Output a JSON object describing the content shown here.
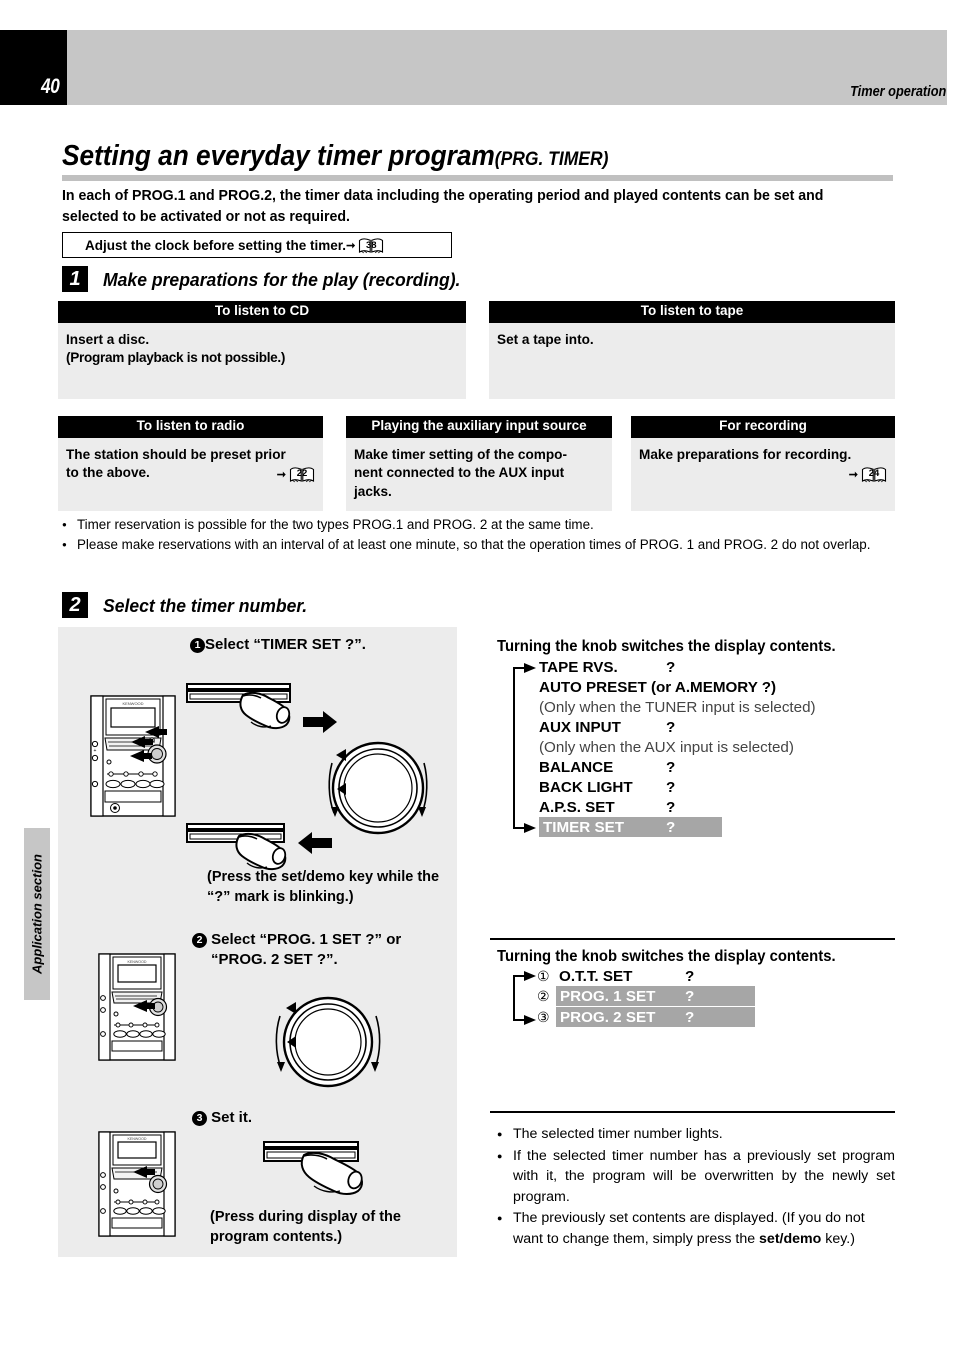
{
  "header": {
    "page_number": "40",
    "section_title": "Timer operation",
    "side_tab_label": "Application section"
  },
  "title": {
    "main": "Setting an everyday timer program",
    "suffix": "(PRG. TIMER)"
  },
  "intro": "In each of PROG.1 and PROG.2, the timer data including the operating period and played contents can be set and selected to be activated or not as required.",
  "note_box": {
    "text": "Adjust the clock before setting the timer.",
    "arrow": "➜",
    "page_ref": "38"
  },
  "step1": {
    "badge": "1",
    "heading": "Make preparations for the play (recording).",
    "boxes": [
      {
        "title": "To listen to CD",
        "lines": [
          "Insert a disc.",
          "(Program playback is not possible.)"
        ],
        "page_ref": ""
      },
      {
        "title": "To listen to tape",
        "lines": [
          "Set a tape into."
        ],
        "page_ref": ""
      },
      {
        "title": "To listen to radio",
        "lines": [
          "The station should be preset prior",
          "to the above."
        ],
        "page_ref": "22"
      },
      {
        "title": "Playing the auxiliary input source",
        "lines": [
          "Make timer setting of the compo-",
          "nent connected to the AUX input",
          "jacks."
        ],
        "page_ref": ""
      },
      {
        "title": "For recording",
        "lines": [
          "Make preparations for recording."
        ],
        "page_ref": "24"
      }
    ],
    "bullets": [
      "Timer reservation is possible for the two types PROG.1 and PROG. 2 at the same time.",
      "Please make reservations with an interval of at least one minute, so that the operation times of PROG. 1 and PROG. 2 do not overlap."
    ]
  },
  "step2": {
    "badge": "2",
    "heading": "Select the timer number.",
    "sub1": {
      "marker": "1",
      "text": "Select “TIMER SET ?”.",
      "caption": "(Press the set/demo key while the “?” mark is blinking.)"
    },
    "sub2": {
      "marker": "2",
      "text_line1": "Select “PROG. 1 SET ?” or",
      "text_line2": "“PROG. 2 SET ?”."
    },
    "sub3": {
      "marker": "3",
      "text": "Set it.",
      "caption": "(Press during display of the program contents.)"
    },
    "display_heading_1": "Turning the knob switches the display contents.",
    "display_rows_1": [
      {
        "label": "TAPE RVS.",
        "value": "?",
        "style": "bold"
      },
      {
        "label": "AUTO PRESET (or A.MEMORY ?)",
        "value": "",
        "style": "bold"
      },
      {
        "label": "(Only when the TUNER input is selected)",
        "value": "",
        "style": "note"
      },
      {
        "label": "AUX INPUT",
        "value": "?",
        "style": "bold"
      },
      {
        "label": "(Only when the AUX input is selected)",
        "value": "",
        "style": "note"
      },
      {
        "label": "BALANCE",
        "value": "?",
        "style": "bold"
      },
      {
        "label": "BACK LIGHT",
        "value": "?",
        "style": "bold"
      },
      {
        "label": "A.P.S. SET",
        "value": "?",
        "style": "bold"
      },
      {
        "label": "TIMER SET",
        "value": "?",
        "style": "highlight"
      }
    ],
    "display_heading_2": "Turning the knob switches the display contents.",
    "display_rows_2": [
      {
        "num": "①",
        "label": "O.T.T.  SET",
        "value": "?",
        "style": "bold"
      },
      {
        "num": "②",
        "label": "PROG. 1  SET",
        "value": "?",
        "style": "highlight"
      },
      {
        "num": "③",
        "label": "PROG. 2  SET",
        "value": "?",
        "style": "highlight"
      }
    ],
    "bullets": [
      "The selected timer number lights.",
      "If the selected timer number has a previously set program with it, the program will be overwritten by the newly set program.",
      "The previously set contents are displayed. (If you do not want to change them, simply press the set/demo key.)"
    ],
    "bullet3_bold_term": "set/demo"
  },
  "colors": {
    "header_gray": "#c6c6c6",
    "panel_gray": "#ececec",
    "highlight_gray": "#a6a6a6",
    "black": "#000000"
  },
  "icons": {
    "book_ref": "book-page-reference-icon",
    "arrow_right": "arrow-right-icon",
    "arrow_left": "arrow-left-icon",
    "knob": "rotary-knob-icon",
    "hand": "pointing-hand-icon",
    "stereo": "stereo-system-icon"
  }
}
